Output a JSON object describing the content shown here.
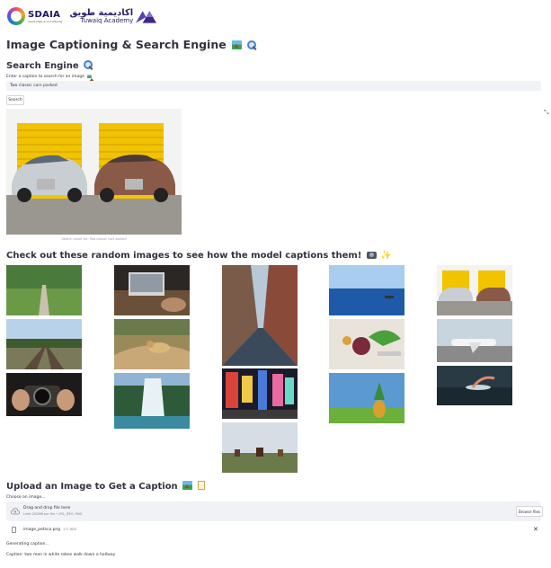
{
  "logos": {
    "sdaia_name": "SDAIA",
    "sdaia_subtitle": "Saudi Data & AI Authority",
    "tuwaiq_arabic": "اكاديمية طويق",
    "tuwaiq_english": "Tuwaiq Academy"
  },
  "page_title": "Image Captioning & Search Engine",
  "search": {
    "heading": "Search Engine",
    "label": "Enter a caption to search for an image",
    "input_value": "Two classic cars parked",
    "button_label": "Search",
    "result_caption": "Search result for: Two classic cars parked"
  },
  "random": {
    "heading": "Check out these random images to see how the model captions them!"
  },
  "upload": {
    "heading": "Upload an Image to Get a Caption",
    "label": "Choose an image...",
    "drop_title": "Drag and drop file here",
    "drop_limit": "Limit 200MB per file • JPG, JPEG, PNG",
    "browse_label": "Browse files",
    "file_name": "image_petsco.png",
    "file_size": "171.6KB",
    "status": "Generating caption...",
    "caption_result": "Caption: two men in white robes walk down a hallway"
  },
  "icons": {
    "expand": "fullscreen-icon",
    "upload": "cloud-upload-icon",
    "file": "file-icon",
    "close": "close-icon"
  }
}
